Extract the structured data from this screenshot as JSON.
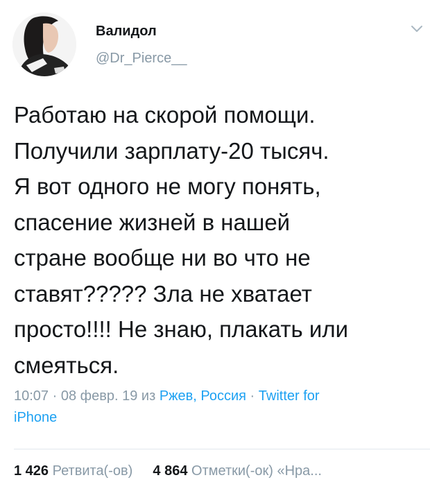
{
  "author": {
    "display_name": "Валидол",
    "handle": "@Dr_Pierce__"
  },
  "tweet": {
    "text_lines": [
      "Работаю на скорой помощи.",
      "Получили зарплату-20 тысяч.",
      "Я вот одного не могу понять,",
      "спасение жизней в нашей",
      "стране вообще ни во что не",
      "ставят????? Зла не хватает",
      "просто!!!! Не знаю, плакать или",
      "смеяться."
    ],
    "time": "10:07",
    "date": "08 февр. 19",
    "from_label": "из",
    "location": "Ржев, Россия",
    "source_part1": "Twitter for",
    "source_part2": "iPhone"
  },
  "stats": {
    "retweets_count": "1 426",
    "retweets_label": "Ретвита(-ов)",
    "likes_count": "4 864",
    "likes_label": "Отметки(-ок)",
    "quote_label": "«Нра..."
  },
  "colors": {
    "text": "#14171a",
    "secondary": "#8899a6",
    "link": "#1da1f2",
    "divider": "#e1e8ed"
  },
  "icons": {
    "menu": "chevron-down-icon"
  }
}
